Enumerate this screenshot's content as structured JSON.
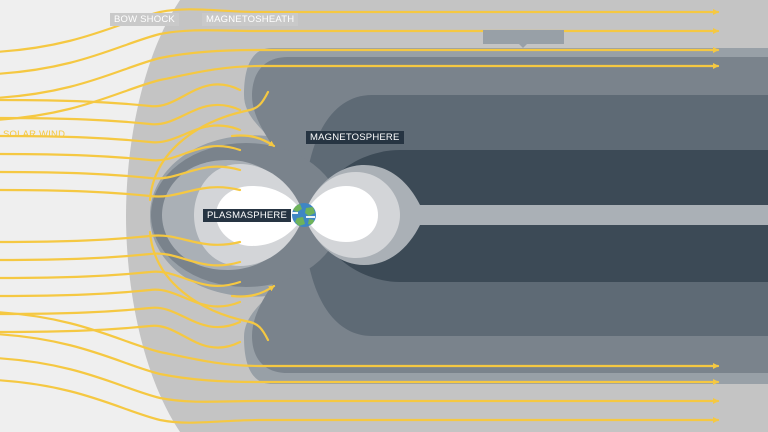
{
  "labels": {
    "bow_shock": "BOW SHOCK",
    "magnetosheath": "MAGNETOSHEATH",
    "solar_wind": "SOLAR WIND",
    "magnetosphere": "MAGNETOSPHERE",
    "plasmasphere": "PLASMASPHERE"
  },
  "colors": {
    "background": "#efefef",
    "magnetosheath": "#c4c4c4",
    "magnetosphere_outer": "#98a0a7",
    "tail_layer_2": "#7a838c",
    "tail_layer_3": "#5e6a75",
    "tail_core": "#3c4a56",
    "inner_lobe": "#aab0b6",
    "plasmasphere_ring": "#d3d5d8",
    "plasmasphere_core": "#ffffff",
    "field_lines": "#f5c842",
    "earth_ocean": "#3f86c4",
    "earth_land": "#6fb35a"
  },
  "icons": {
    "earth": "earth-icon",
    "flow_arrow": "arrow-right-icon"
  }
}
